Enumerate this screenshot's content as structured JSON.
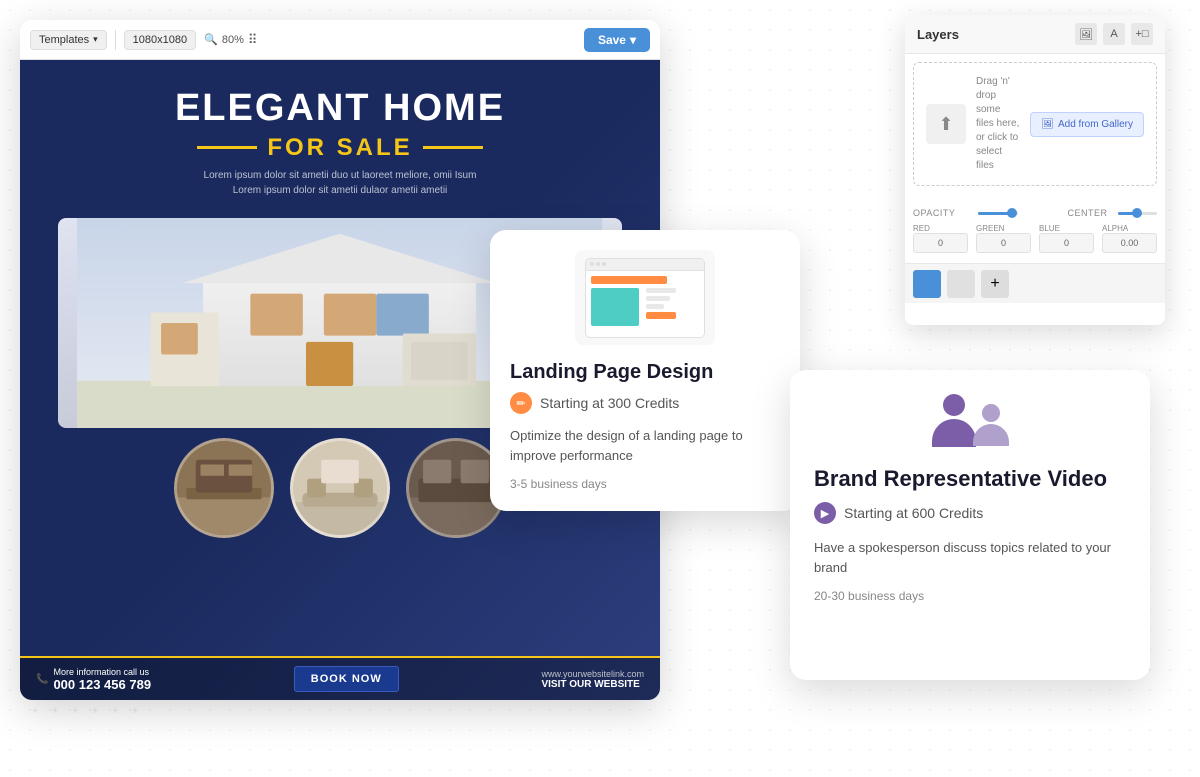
{
  "background": {
    "color": "#ffffff"
  },
  "editor": {
    "toolbar": {
      "templates_label": "Templates",
      "size_label": "1080x1080",
      "zoom_label": "80%",
      "save_label": "Save"
    },
    "layers_panel": {
      "title": "Layers",
      "drop_text": "Drag 'n' drop some files here, or click to select files",
      "add_gallery_label": "Add from Gallery",
      "opacity_label": "OPACITY",
      "center_label": "CENTER",
      "red_label": "RED",
      "green_label": "GREEN",
      "blue_label": "BLUE",
      "alpha_label": "ALPHA",
      "alpha_value": "0.00"
    }
  },
  "flyer": {
    "elegant": "ELEGANT HOME",
    "for_sale": "FOR SALE",
    "description": "Lorem ipsum dolor sit ametii duo ut laoreet meliore, omii Isum\nLorem ipsum dolor sit ametii dulaor ametii ametii",
    "contact_label": "More information call us",
    "phone": "000 123 456 789",
    "book_btn": "BOOK NOW",
    "website_label": "www.yourwebsitelink.com",
    "visit_label": "VISIT OUR WEBSITE"
  },
  "landing_card": {
    "title": "Landing Page Design",
    "credits_label": "Starting at 300 Credits",
    "description": "Optimize the design of a landing page to improve performance",
    "days_label": "3-5 business days"
  },
  "brand_card": {
    "title": "Brand Representative Video",
    "credits_label": "Starting at 600 Credits",
    "description": "Have a spokesperson discuss topics related to your brand",
    "days_label": "20-30 business days"
  }
}
